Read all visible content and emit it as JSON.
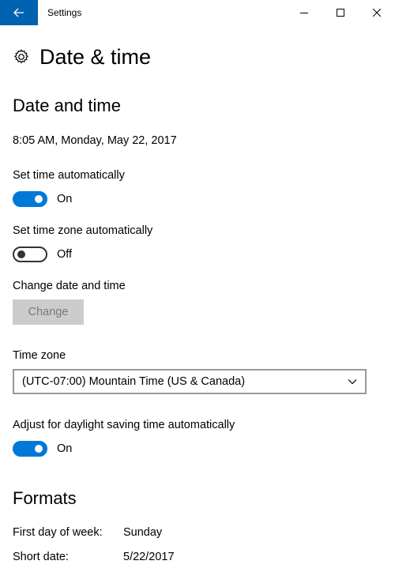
{
  "window": {
    "title": "Settings"
  },
  "page": {
    "title": "Date & time"
  },
  "date_time": {
    "section_title": "Date and time",
    "current": "8:05 AM, Monday, May 22, 2017",
    "set_time_auto": {
      "label": "Set time automatically",
      "state": "On",
      "on": true
    },
    "set_tz_auto": {
      "label": "Set time zone automatically",
      "state": "Off",
      "on": false
    },
    "change": {
      "label": "Change date and time",
      "button": "Change"
    },
    "time_zone": {
      "label": "Time zone",
      "value": "(UTC-07:00) Mountain Time (US & Canada)"
    },
    "dst": {
      "label": "Adjust for daylight saving time automatically",
      "state": "On",
      "on": true
    }
  },
  "formats": {
    "section_title": "Formats",
    "rows": [
      {
        "key": "First day of week:",
        "value": "Sunday"
      },
      {
        "key": "Short date:",
        "value": "5/22/2017"
      }
    ]
  },
  "colors": {
    "accent": "#0078d7",
    "back_button": "#0063b1",
    "disabled_button": "#cccccc"
  },
  "icons": {
    "back": "arrow-left-icon",
    "minimize": "minimize-icon",
    "maximize": "maximize-icon",
    "close": "close-icon",
    "page": "gear-icon",
    "dropdown": "chevron-down-icon"
  }
}
